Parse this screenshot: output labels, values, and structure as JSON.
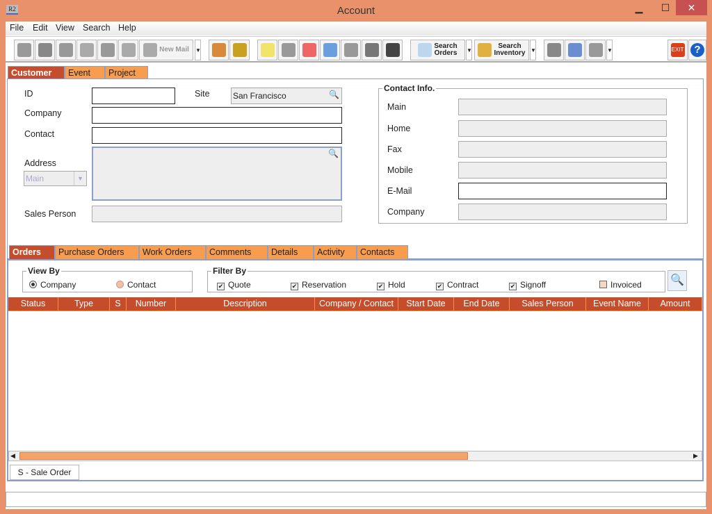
{
  "window": {
    "title": "Account",
    "app_icon": "R2",
    "minimize": "▁",
    "maximize": "☐",
    "close": "✕"
  },
  "menu": [
    "File",
    "Edit",
    "View",
    "Search",
    "Help"
  ],
  "toolbar": {
    "new_mail": "New Mail",
    "search_orders": [
      "Search",
      "Orders"
    ],
    "search_inventory": [
      "Search",
      "Inventory"
    ],
    "exit": "EXIT",
    "help": "?"
  },
  "top_tabs": [
    "Customer",
    "Event",
    "Project"
  ],
  "customer": {
    "id_label": "ID",
    "id": "",
    "site_label": "Site",
    "site": "San Francisco",
    "company_label": "Company",
    "company": "",
    "contact_label": "Contact",
    "contact": "",
    "address_label": "Address",
    "address_type": "Main",
    "address": "",
    "sales_person_label": "Sales Person",
    "sales_person": ""
  },
  "contact_info": {
    "title": "Contact Info.",
    "fields": [
      {
        "label": "Main",
        "value": ""
      },
      {
        "label": "Home",
        "value": ""
      },
      {
        "label": "Fax",
        "value": ""
      },
      {
        "label": "Mobile",
        "value": ""
      },
      {
        "label": "E-Mail",
        "value": ""
      },
      {
        "label": "Company",
        "value": ""
      }
    ]
  },
  "bottom_tabs": [
    "Orders",
    "Purchase Orders",
    "Work Orders",
    "Comments",
    "Details",
    "Activity",
    "Contacts"
  ],
  "view_by": {
    "title": "View By",
    "options": [
      "Company",
      "Contact"
    ],
    "selected": "Company"
  },
  "filter_by": {
    "title": "Filter By",
    "options": [
      {
        "label": "Quote",
        "checked": true
      },
      {
        "label": "Reservation",
        "checked": true
      },
      {
        "label": "Hold",
        "checked": true
      },
      {
        "label": "Contract",
        "checked": true
      },
      {
        "label": "Signoff",
        "checked": true
      },
      {
        "label": "Invoiced",
        "checked": false
      }
    ]
  },
  "table": {
    "columns": [
      "Status",
      "Type",
      "S",
      "Number",
      "Description",
      "Company / Contact",
      "Start Date",
      "End Date",
      "Sales Person",
      "Event Name",
      "Amount"
    ],
    "rows": []
  },
  "legend_tab": "S - Sale Order",
  "status_bar": ""
}
